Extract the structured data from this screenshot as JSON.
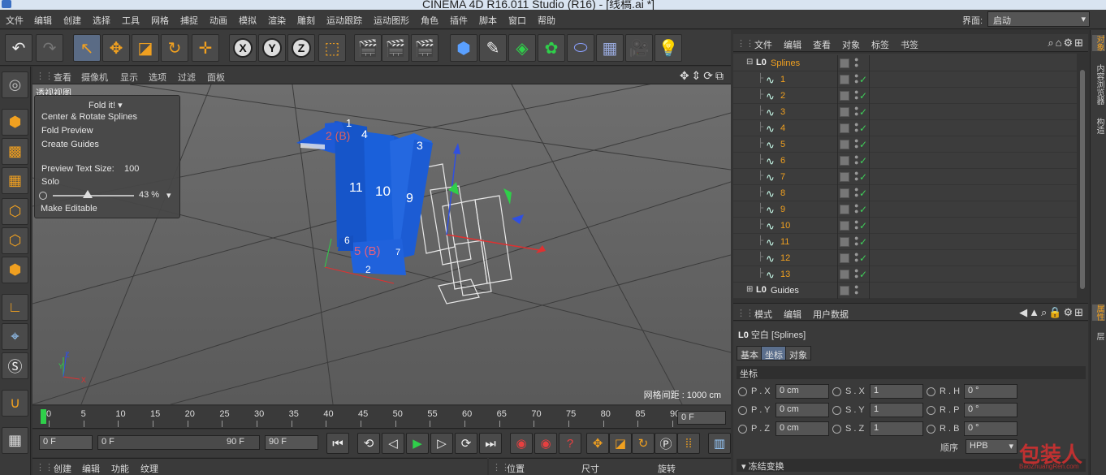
{
  "window": {
    "title": "CINEMA 4D R16.011 Studio (R16) - [线稿.ai *]"
  },
  "menubar": {
    "items": [
      "文件",
      "编辑",
      "创建",
      "选择",
      "工具",
      "网格",
      "捕捉",
      "动画",
      "模拟",
      "渲染",
      "雕刻",
      "运动跟踪",
      "运动图形",
      "角色",
      "插件",
      "脚本",
      "窗口",
      "帮助"
    ],
    "layout_label": "界面:",
    "layout_value": "启动"
  },
  "viewport": {
    "menu": [
      "查看",
      "摄像机",
      "显示",
      "选项",
      "过滤",
      "面板"
    ],
    "label": "透视视图",
    "grid_distance": "网格间距 : 1000 cm",
    "model_labels": [
      "1",
      "2 (B)",
      "4",
      "3",
      "11",
      "10",
      "9",
      "6",
      "5 (B)",
      "7",
      "2"
    ]
  },
  "fold_panel": {
    "header": "Fold it!",
    "items": [
      "Center & Rotate Splines",
      "Fold Preview",
      "Create Guides"
    ],
    "preview_text_size_label": "Preview Text Size:",
    "preview_text_size_value": "100",
    "solo_label": "Solo",
    "slider_value": "43 %",
    "slider_fraction": 0.43,
    "make_editable": "Make Editable"
  },
  "timeline": {
    "ticks": [
      "0",
      "5",
      "10",
      "15",
      "20",
      "25",
      "30",
      "35",
      "40",
      "45",
      "50",
      "55",
      "60",
      "65",
      "70",
      "75",
      "80",
      "85",
      "90"
    ],
    "current_frame": "0 F",
    "start_frame": "0 F",
    "range_min": "0 F",
    "range_max": "90 F",
    "end_frame": "90 F"
  },
  "material_bar": [
    "创建",
    "编辑",
    "功能",
    "纹理"
  ],
  "coord_bar": [
    "位置",
    "尺寸",
    "旋转"
  ],
  "object_manager": {
    "menu": [
      "文件",
      "编辑",
      "查看",
      "对象",
      "标签",
      "书签"
    ],
    "root": "Splines",
    "children": [
      "1",
      "2",
      "3",
      "4",
      "5",
      "6",
      "7",
      "8",
      "9",
      "10",
      "11",
      "12",
      "13"
    ],
    "guides": "Guides"
  },
  "side_tabs": {
    "top": [
      "对象",
      "内容浏览器",
      "构造"
    ],
    "bottom": [
      "属性",
      "层"
    ]
  },
  "attribute_manager": {
    "menu": [
      "模式",
      "编辑",
      "用户数据"
    ],
    "title": "空白 [Splines]",
    "tabs": [
      "基本",
      "坐标",
      "对象"
    ],
    "active_tab": "坐标",
    "section": "坐标",
    "pos": [
      {
        "label": "P . X",
        "value": "0 cm"
      },
      {
        "label": "P . Y",
        "value": "0 cm"
      },
      {
        "label": "P . Z",
        "value": "0 cm"
      }
    ],
    "scale": [
      {
        "label": "S . X",
        "value": "1"
      },
      {
        "label": "S . Y",
        "value": "1"
      },
      {
        "label": "S . Z",
        "value": "1"
      }
    ],
    "rot": [
      {
        "label": "R . H",
        "value": "0 °"
      },
      {
        "label": "R . P",
        "value": "0 °"
      },
      {
        "label": "R . B",
        "value": "0 °"
      }
    ],
    "order_label": "顺序",
    "order_value": "HPB",
    "freeze_label": "冻结变换"
  },
  "watermark": {
    "text": "包装人",
    "url": "BaoZhuangRen.com"
  },
  "colors": {
    "accent": "#f0a020",
    "model": "#1a5fd6",
    "check": "#3fd05a"
  }
}
